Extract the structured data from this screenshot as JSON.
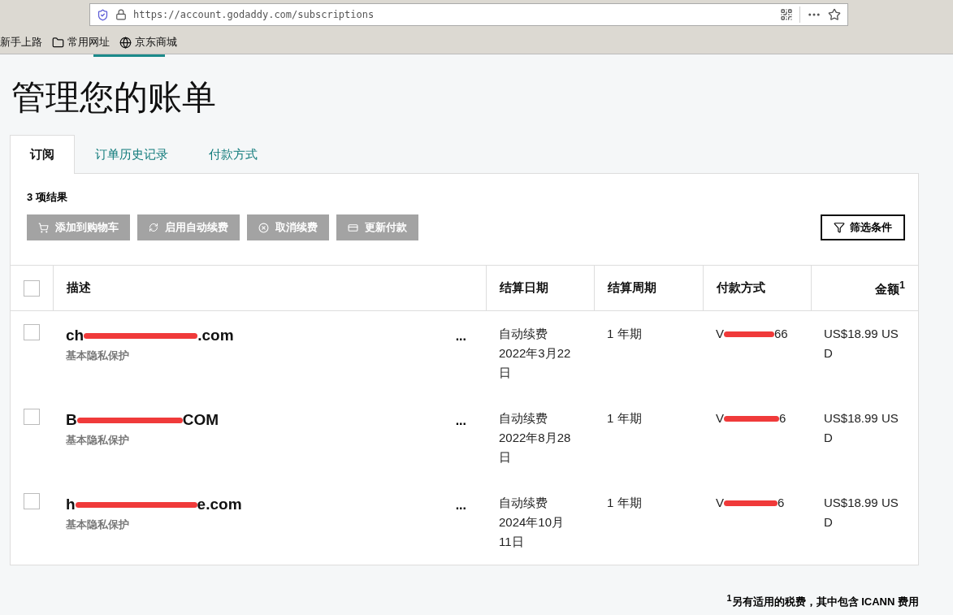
{
  "browser": {
    "url": "https://account.godaddy.com/subscriptions",
    "bookmarks": [
      {
        "kind": "plain",
        "label": "新手上路"
      },
      {
        "kind": "folder",
        "label": "常用网址"
      },
      {
        "kind": "globe",
        "label": "京东商城"
      }
    ]
  },
  "title": "管理您的账单",
  "tabs": [
    {
      "label": "订阅",
      "selected": true
    },
    {
      "label": "订单历史记录",
      "selected": false
    },
    {
      "label": "付款方式",
      "selected": false
    }
  ],
  "result_count": "3 项结果",
  "actions": [
    {
      "kind": "cart",
      "label": "添加到购物车",
      "disabled": true
    },
    {
      "kind": "renew",
      "label": "启用自动续费",
      "disabled": true
    },
    {
      "kind": "cancel",
      "label": "取消续费",
      "disabled": true
    },
    {
      "kind": "card",
      "label": "更新付款",
      "disabled": true
    }
  ],
  "filter_button": "筛选条件",
  "table": {
    "select_all_checked": false,
    "columns": [
      "描述",
      "结算日期",
      "结算周期",
      "付款方式",
      "金额$^{1}$"
    ],
    "rows": [
      {
        "checked": false,
        "domain_start": "ch",
        "domain_end": ".com",
        "product": "基本隐私保护",
        "more": "...",
        "date": [
          "自动续费",
          "2022年3月22",
          "日"
        ],
        "period": "1 年期",
        "pay_start": "V",
        "pay_end": "66",
        "amount": "US$18.99 USD"
      },
      {
        "checked": false,
        "domain_start": "B",
        "domain_end": "COM",
        "product": "基本隐私保护",
        "more": "...",
        "date": [
          "自动续费",
          "2022年8月28",
          "日"
        ],
        "period": "1 年期",
        "pay_start": "V",
        "pay_end": "6",
        "amount": "US$18.99 USD"
      },
      {
        "checked": false,
        "domain_start": "h",
        "domain_end": "e.com",
        "product": "基本隐私保护",
        "more": "...",
        "date": [
          "自动续费",
          "2024年10月",
          "11日"
        ],
        "period": "1 年期",
        "pay_start": "V",
        "pay_end": "6",
        "amount": "US$18.99 USD"
      }
    ]
  },
  "footnote": "$^{1}$另有适用的税费，其中包含 ICANN 费用"
}
